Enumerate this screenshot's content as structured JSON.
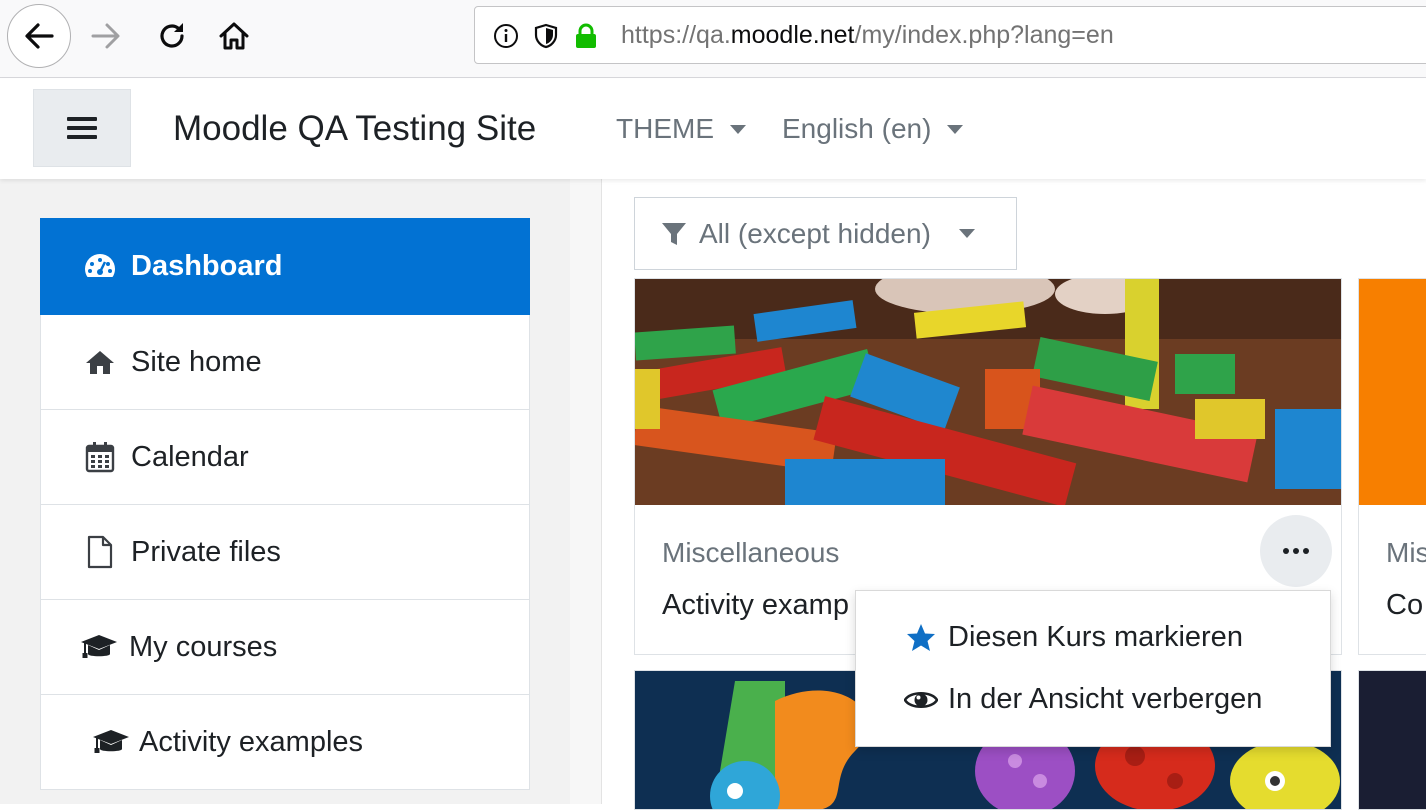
{
  "browser": {
    "url_prefix": "https://qa.",
    "url_host": "moodle.net",
    "url_path": "/my/index.php?lang=en"
  },
  "navbar": {
    "site_name": "Moodle QA Testing Site",
    "theme_label": "THEME",
    "language_label": "English (en)"
  },
  "sidebar": {
    "items": [
      {
        "label": "Dashboard",
        "icon": "dashboard-icon",
        "active": true
      },
      {
        "label": "Site home",
        "icon": "home-icon"
      },
      {
        "label": "Calendar",
        "icon": "calendar-icon"
      },
      {
        "label": "Private files",
        "icon": "file-icon"
      },
      {
        "label": "My courses",
        "icon": "graduation-cap-icon"
      },
      {
        "label": "Activity examples",
        "icon": "graduation-cap-icon"
      }
    ]
  },
  "main": {
    "filter_label": "All (except hidden)",
    "courses": [
      {
        "category": "Miscellaneous",
        "name": "Activity examp"
      },
      {
        "category": "Mis",
        "name": "Co"
      }
    ]
  },
  "course_menu": {
    "items": [
      {
        "label": "Diesen Kurs markieren",
        "icon": "star-icon"
      },
      {
        "label": "In der Ansicht verbergen",
        "icon": "eye-icon"
      }
    ]
  },
  "colors": {
    "primary": "#0272d3",
    "secure_lock": "#12bc00"
  }
}
